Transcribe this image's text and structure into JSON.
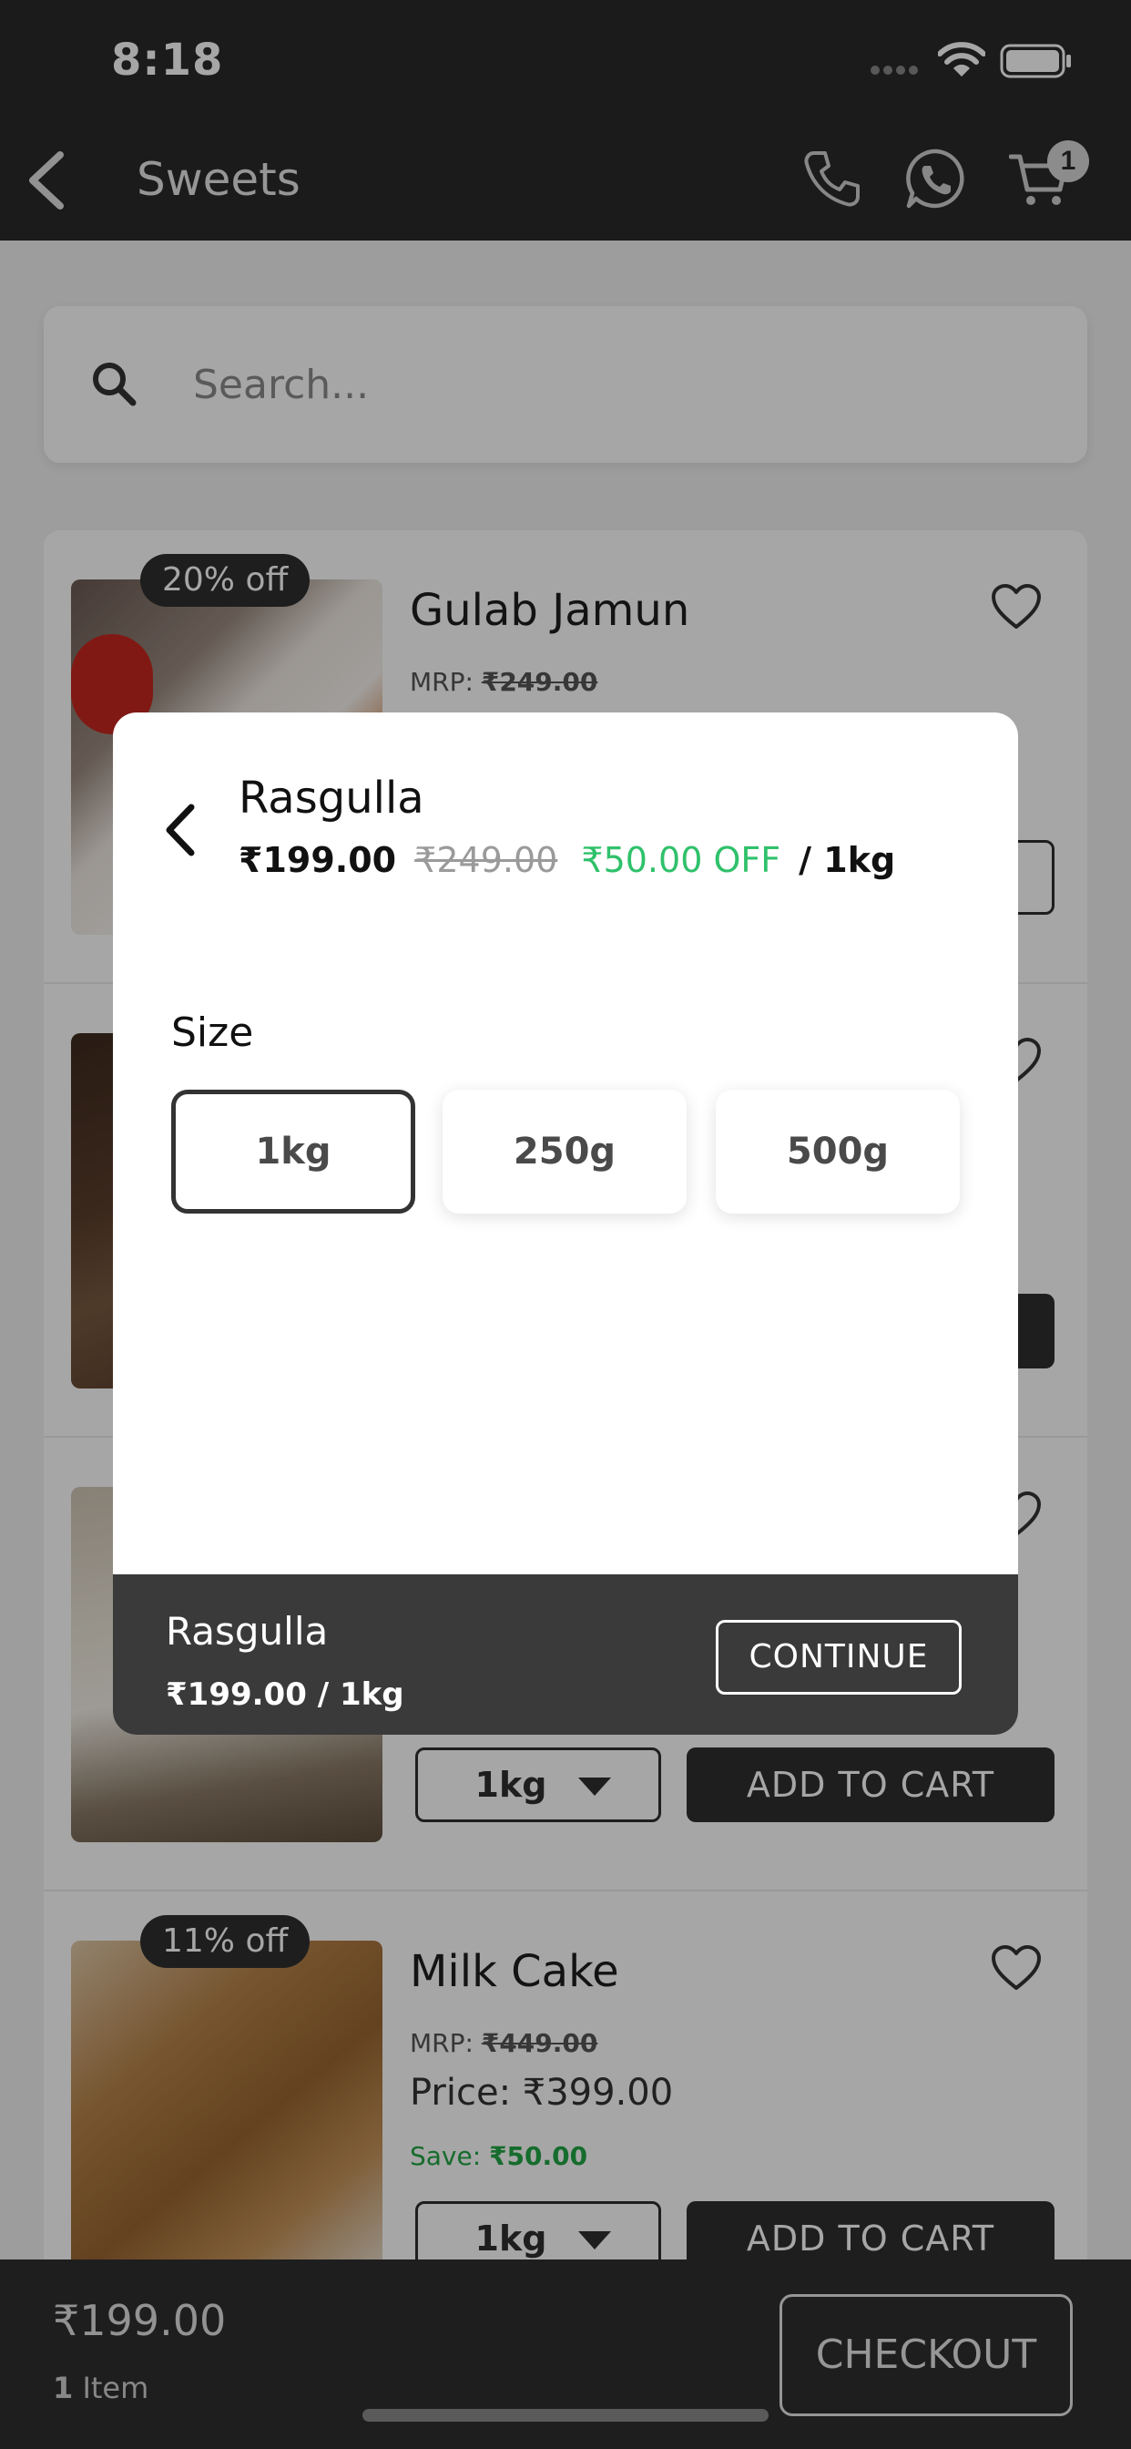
{
  "status_bar": {
    "time": "8:18"
  },
  "header": {
    "title": "Sweets",
    "cart_count": "1"
  },
  "search": {
    "placeholder": "Search..."
  },
  "products": [
    {
      "name": "Gulab Jamun",
      "discount": "20% off",
      "mrp_label": "MRP:",
      "mrp": "₹249.00",
      "button": ""
    },
    {
      "name": "",
      "discount": "",
      "mrp_label": "",
      "mrp": "",
      "button": ""
    },
    {
      "name": "",
      "discount": "",
      "size": "1kg",
      "button": "ADD TO CART"
    },
    {
      "name": "Milk Cake",
      "discount": "11% off",
      "mrp_label": "MRP:",
      "mrp": "₹449.00",
      "price_label": "Price:",
      "price": "₹399.00",
      "save_label": "Save:",
      "save": "₹50.00",
      "size": "1kg",
      "button": "ADD TO CART"
    }
  ],
  "bottom_bar": {
    "total": "₹199.00",
    "count": "1",
    "count_label": "Item",
    "checkout": "CHECKOUT"
  },
  "modal": {
    "title": "Rasgulla",
    "price": "₹199.00",
    "mrp": "₹249.00",
    "off": "₹50.00 OFF",
    "unit": "/ 1kg",
    "size_label": "Size",
    "sizes": [
      "1kg",
      "250g",
      "500g"
    ],
    "selected_size": "1kg",
    "footer_name": "Rasgulla",
    "footer_price": "₹199.00 / 1kg",
    "continue": "CONTINUE"
  },
  "colors": {
    "dark": "#2a2a2a",
    "green": "#2fc16b",
    "save_green": "#22a645"
  }
}
